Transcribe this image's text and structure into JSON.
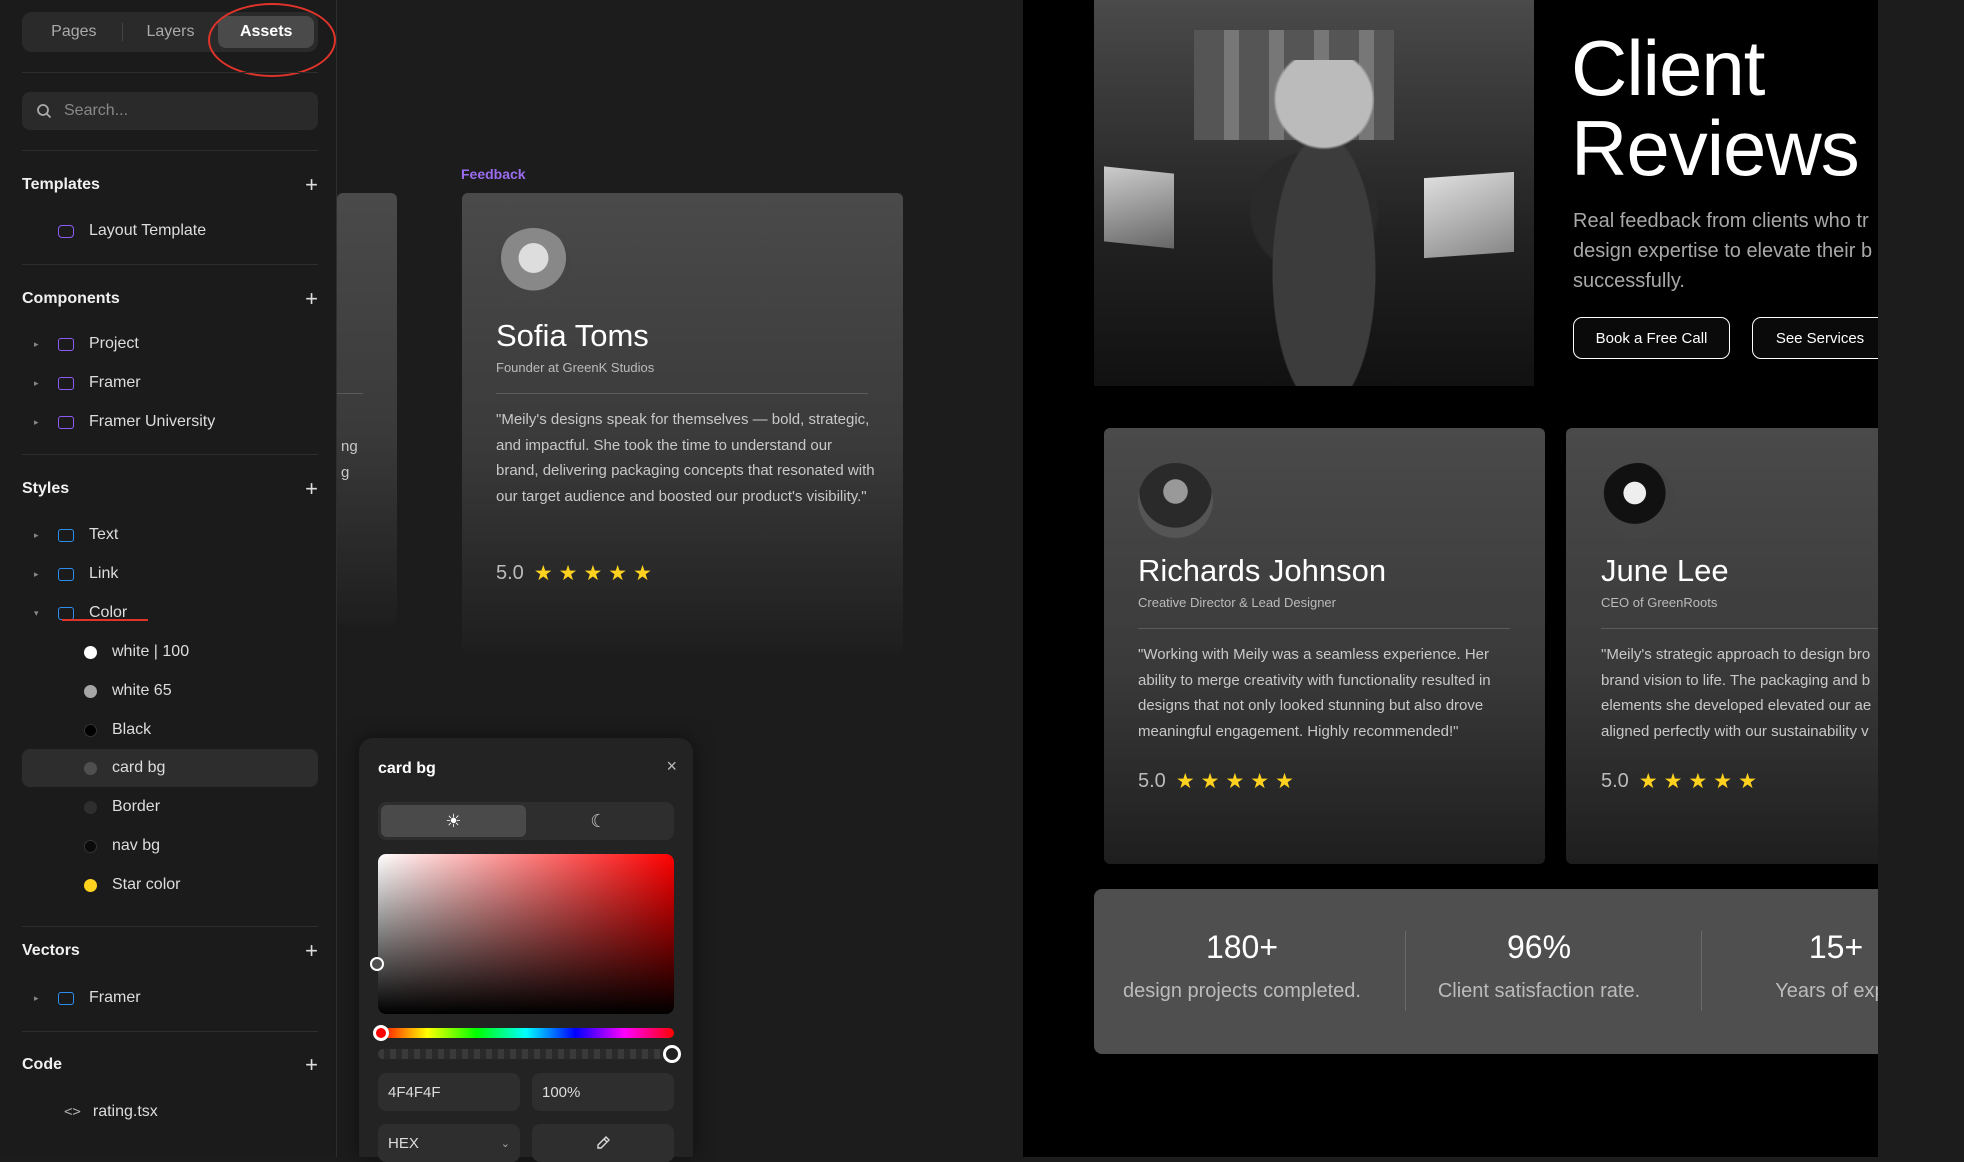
{
  "sidebar": {
    "tabs": [
      "Pages",
      "Layers",
      "Assets"
    ],
    "search_placeholder": "Search...",
    "sections": {
      "templates": "Templates",
      "components": "Components",
      "styles": "Styles",
      "vectors": "Vectors",
      "code": "Code"
    },
    "templates": [
      "Layout Template"
    ],
    "components": [
      "Project",
      "Framer",
      "Framer University"
    ],
    "styles": [
      "Text",
      "Link",
      "Color"
    ],
    "colors": [
      {
        "name": "white | 100",
        "color": "#ffffff"
      },
      {
        "name": "white 65",
        "color": "#a6a6a6"
      },
      {
        "name": "Black",
        "color": "#000000"
      },
      {
        "name": "card bg",
        "color": "#4f4f4f"
      },
      {
        "name": "Border",
        "color": "#2e2e2e"
      },
      {
        "name": "nav bg",
        "color": "#0a0a0a"
      },
      {
        "name": "Star color",
        "color": "#ffd21f"
      }
    ],
    "vectors": [
      "Framer"
    ],
    "code": [
      "rating.tsx"
    ]
  },
  "canvas": {
    "frame_label": "Feedback",
    "partial_card_text": [
      "ng",
      "g"
    ],
    "card": {
      "name": "Sofia Toms",
      "role": "Founder at GreenK Studios",
      "quote": "\"Meily's designs speak for themselves — bold, strategic, and impactful. She took the time to understand our brand, delivering packaging concepts that resonated with our target audience and boosted our product's visibility.\"",
      "rating": "5.0",
      "stars": 5
    }
  },
  "color_picker": {
    "title": "card bg",
    "close": "×",
    "hex": "4F4F4F",
    "opacity": "100%",
    "format": "HEX",
    "light_icon": "sun-icon",
    "dark_icon": "moon-icon"
  },
  "preview": {
    "title_line1": "Client",
    "title_line2": "Reviews",
    "sub_line1": "Real feedback from clients who tr",
    "sub_line2": "design expertise to elevate their b",
    "sub_line3": "successfully.",
    "btn_call": "Book a Free Call",
    "btn_services": "See Services",
    "reviews": [
      {
        "name": "Richards Johnson",
        "role": "Creative Director & Lead Designer",
        "quote": "\"Working with Meily was a seamless experience. Her ability to merge creativity with functionality resulted in designs that not only looked stunning but also drove meaningful engagement. Highly recommended!\"",
        "rating": "5.0"
      },
      {
        "name": "June Lee",
        "role": "CEO of GreenRoots",
        "quote_lines": [
          "\"Meily's strategic approach to design bro",
          "brand vision to life. The packaging and b",
          "elements she developed elevated our ae",
          "aligned perfectly with our sustainability v"
        ],
        "rating": "5.0"
      }
    ],
    "stats": [
      {
        "value": "180+",
        "label": "design projects completed."
      },
      {
        "value": "96%",
        "label": "Client satisfaction rate."
      },
      {
        "value": "15+",
        "label": "Years of expe"
      }
    ]
  }
}
